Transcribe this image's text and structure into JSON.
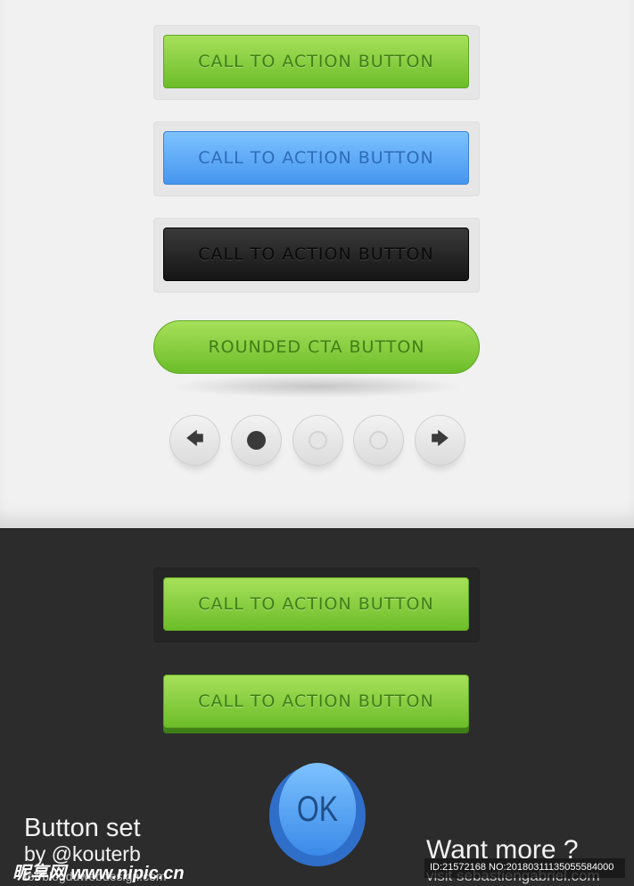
{
  "buttons": {
    "green": "CALL TO ACTION BUTTON",
    "blue": "CALL TO ACTION BUTTON",
    "black": "CALL TO ACTION BUTTON",
    "rounded": "ROUNDED CTA BUTTON",
    "dark_green": "CALL TO ACTION BUTTON",
    "dark_green_3d": "CALL TO ACTION BUTTON",
    "ok": "OK"
  },
  "pagination": {
    "items": [
      "prev-arrow",
      "active-dot",
      "dot",
      "dot",
      "next-arrow"
    ],
    "active_index": 1
  },
  "footer": {
    "title": "Button set",
    "author": "by @kouterb",
    "for": "for blogduwebdesign.com",
    "want_more": "Want more ?",
    "visit": "visit sebastiengabriel.com"
  },
  "watermark": {
    "site": "昵享网 www.nipic.cn",
    "id": "ID:21572168 NO:20180311135055584000"
  },
  "colors": {
    "green": "#7cc93a",
    "blue": "#5aa8f7",
    "black": "#222222",
    "dark_bg": "#2c2c2c",
    "light_bg": "#f1f1f1"
  }
}
